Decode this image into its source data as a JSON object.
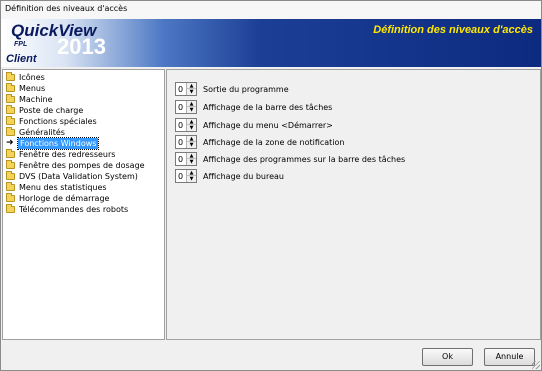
{
  "window": {
    "title": "Définition des niveaux d'accès"
  },
  "banner": {
    "logo_quick": "QuickView",
    "logo_year": "2013",
    "logo_fpl": "FPL",
    "logo_client": "Client",
    "title": "Définition des niveaux d'accès",
    "colors": {
      "title": "#ffe800",
      "background": "#1c3f96"
    }
  },
  "tree": {
    "selected": "Fonctions Windows",
    "items": [
      {
        "label": "Icônes",
        "icon": "folder-icon"
      },
      {
        "label": "Menus",
        "icon": "folder-icon"
      },
      {
        "label": "Machine",
        "icon": "folder-icon"
      },
      {
        "label": "Poste de charge",
        "icon": "folder-icon"
      },
      {
        "label": "Fonctions spéciales",
        "icon": "folder-icon"
      },
      {
        "label": "Généralités",
        "icon": "folder-icon"
      },
      {
        "label": "Fonctions Windows",
        "icon": "arrow-right-icon"
      },
      {
        "label": "Fenêtre des redresseurs",
        "icon": "folder-icon"
      },
      {
        "label": "Fenêtre des pompes de dosage",
        "icon": "folder-icon"
      },
      {
        "label": "DVS (Data Validation System)",
        "icon": "folder-icon"
      },
      {
        "label": "Menu des statistiques",
        "icon": "folder-icon"
      },
      {
        "label": "Horloge de démarrage",
        "icon": "folder-icon"
      },
      {
        "label": "Télécommandes des robots",
        "icon": "folder-icon"
      }
    ]
  },
  "options": [
    {
      "value": "0",
      "label": "Sortie du programme"
    },
    {
      "value": "0",
      "label": "Affichage de la barre des tâches"
    },
    {
      "value": "0",
      "label": "Affichage du menu <Démarrer>"
    },
    {
      "value": "0",
      "label": "Affichage de la zone de notification"
    },
    {
      "value": "0",
      "label": "Affichage des programmes sur la barre des tâches"
    },
    {
      "value": "0",
      "label": "Affichage du bureau"
    }
  ],
  "buttons": {
    "ok": "Ok",
    "cancel": "Annule"
  }
}
